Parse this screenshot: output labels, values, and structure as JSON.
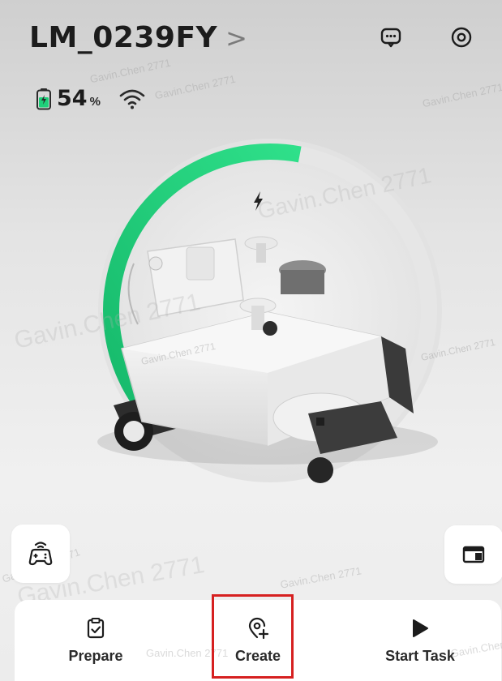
{
  "header": {
    "device_name": "LM_0239FY",
    "chevron": ">",
    "message_icon": "chat-bubble-icon",
    "settings_icon": "target-settings-icon"
  },
  "status": {
    "battery_value": "54",
    "battery_unit": "%",
    "battery_level": 54,
    "battery_icon": "battery-charging-icon",
    "wifi_icon": "wifi-icon"
  },
  "gauge": {
    "level": 0.54,
    "charging_icon": "lightning-icon",
    "accent_color": "#1ecf7a",
    "track_color": "#e6e6e6"
  },
  "watermark_text": "Gavin.Chen 2771",
  "side_buttons": {
    "left_icon": "gamepad-icon",
    "right_icon": "panel-icon"
  },
  "bottom_bar": {
    "actions": [
      {
        "label": "Prepare",
        "icon": "clipboard-check-icon"
      },
      {
        "label": "Create",
        "icon": "location-add-icon"
      },
      {
        "label": "Start Task",
        "icon": "play-icon"
      }
    ]
  },
  "highlight_color": "#d62020"
}
